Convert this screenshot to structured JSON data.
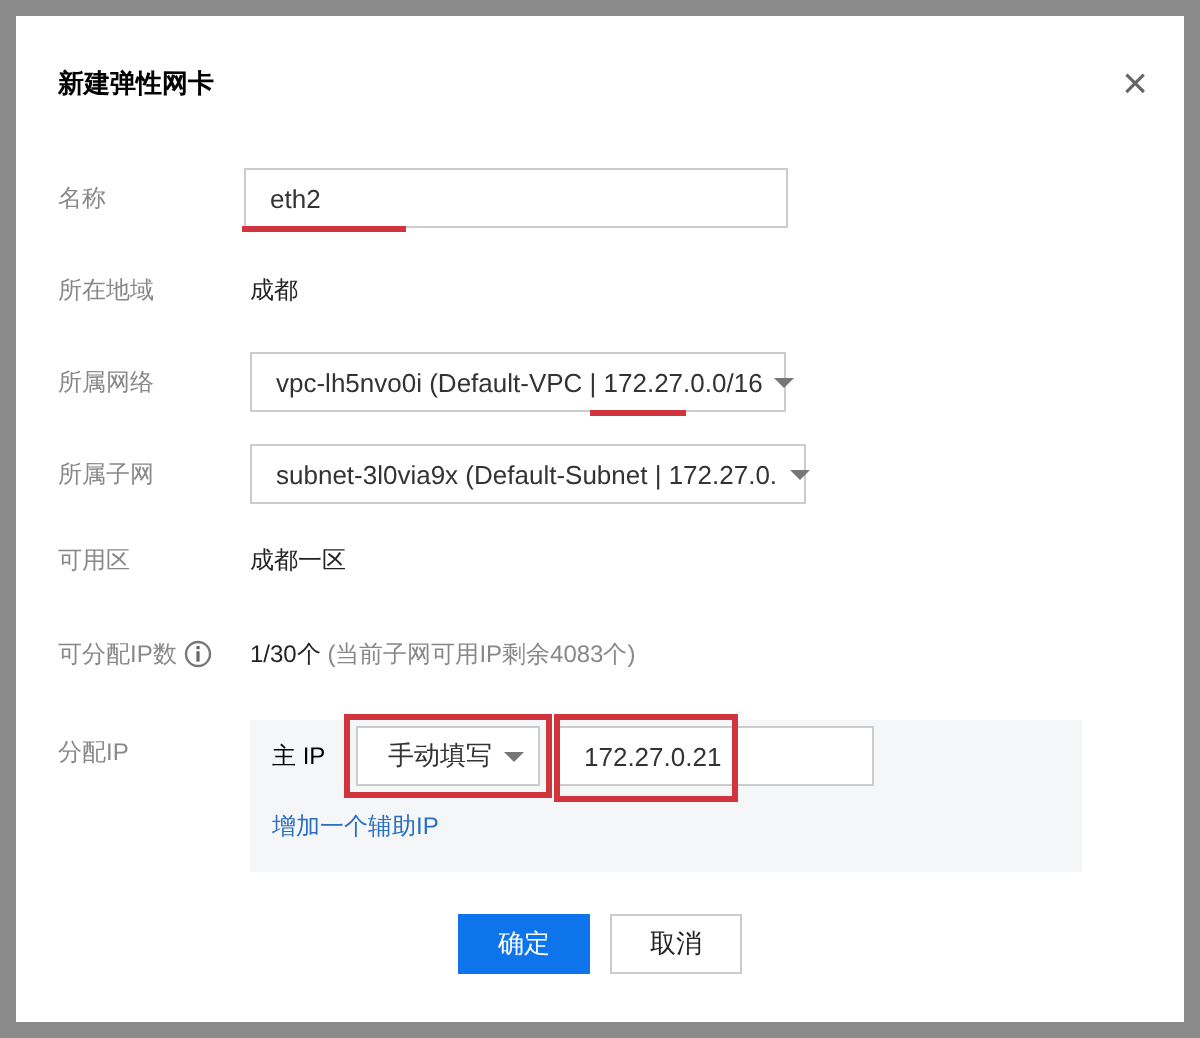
{
  "dialog": {
    "title": "新建弹性网卡",
    "close": "×"
  },
  "fields": [
    {
      "kind": "input",
      "label": "名称",
      "value": "eth2",
      "underlined": true
    },
    {
      "kind": "text",
      "label": "所在地域",
      "value": "成都"
    },
    {
      "kind": "select",
      "label": "所属网络",
      "value": "vpc-lh5nvo0i (Default-VPC | 172.27.0.0/16",
      "underlined": true
    },
    {
      "kind": "select",
      "label": "所属子网",
      "value": "subnet-3l0via9x (Default-Subnet | 172.27.0.",
      "underlined": false
    },
    {
      "kind": "text",
      "label": "可用区",
      "value": "成都一区"
    },
    {
      "kind": "count",
      "label": "可分配IP数",
      "value": "1/30个",
      "note": "(当前子网可用IP剩余4083个)"
    }
  ],
  "ip_assignment": {
    "label": "分配IP",
    "primary_label": "主 IP",
    "mode": {
      "value": "手动填写",
      "highlighted": true
    },
    "address": {
      "value": "172.27.0.21",
      "highlighted": true
    },
    "add_link": "增加一个辅助IP"
  },
  "buttons": [
    {
      "label": "确定",
      "primary": true
    },
    {
      "label": "取消",
      "primary": false
    }
  ]
}
